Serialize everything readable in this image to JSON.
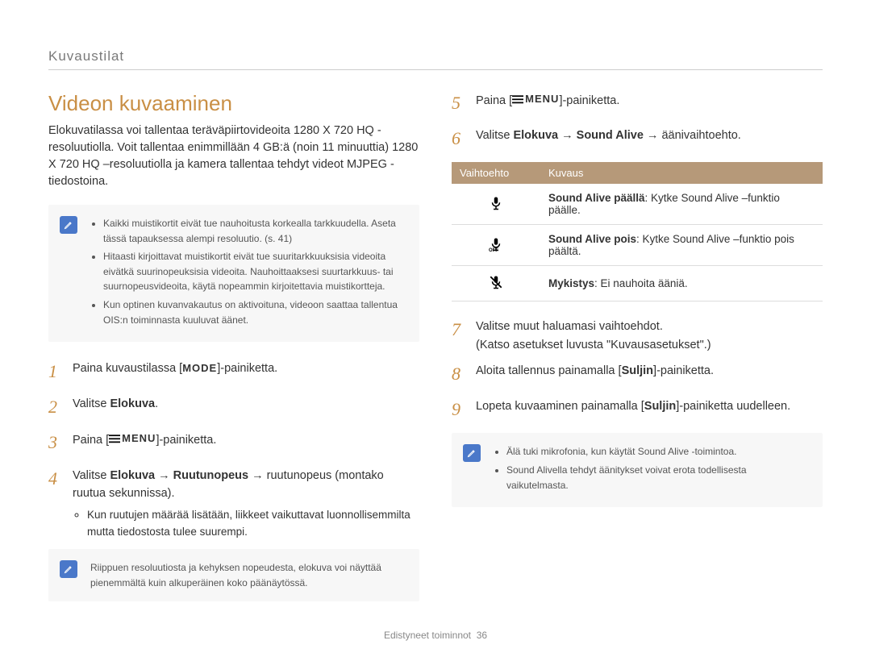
{
  "header": {
    "section_label": "Kuvaustilat"
  },
  "title": "Videon kuvaaminen",
  "intro": "Elokuvatilassa voi tallentaa teräväpiirtovideoita 1280 X 720 HQ -resoluutiolla. Voit tallentaa enimmillään 4 GB:ä (noin 11 minuuttia) 1280 X 720 HQ –resoluutiolla ja kamera tallentaa tehdyt videot MJPEG -tiedostoina.",
  "note_left_1": {
    "items": [
      "Kaikki muistikortit eivät tue nauhoitusta korkealla tarkkuudella. Aseta tässä tapauksessa alempi resoluutio. (s. 41)",
      "Hitaasti kirjoittavat muistikortit eivät tue suuritarkkuuksisia videoita eivätkä suurinopeuksisia videoita. Nauhoittaaksesi suurtarkkuus- tai suurnopeusvideoita, käytä nopeammin kirjoitettavia muistikortteja.",
      "Kun optinen kuvanvakautus on aktivoituna, videoon saattaa tallentua OIS:n toiminnasta kuuluvat äänet."
    ]
  },
  "steps_left": [
    {
      "n": "1",
      "pre": "Paina kuvaustilassa [",
      "mid_label": "MODE",
      "post": "]-painiketta."
    },
    {
      "n": "2",
      "pre": "Valitse ",
      "bold": "Elokuva",
      "post": "."
    },
    {
      "n": "3",
      "pre": "Paina [",
      "icon": "menu",
      "post": "]-painiketta."
    },
    {
      "n": "4",
      "parts": [
        "Valitse ",
        "Elokuva",
        " → ",
        "Ruutunopeus",
        " → ruutunopeus (montako ruutua sekunnissa)."
      ],
      "bullet": "Kun ruutujen määrää lisätään, liikkeet vaikuttavat luonnollisemmilta mutta tiedostosta tulee suurempi."
    }
  ],
  "note_left_2": "Riippuen resoluutiosta ja kehyksen nopeudesta, elokuva voi näyttää pienemmältä kuin alkuperäinen koko päänäytössä.",
  "steps_right_top": [
    {
      "n": "5",
      "pre": "Paina [",
      "icon": "menu",
      "post": "]-painiketta."
    },
    {
      "n": "6",
      "parts": [
        "Valitse ",
        "Elokuva",
        " → ",
        "Sound Alive",
        " → äänivaihtoehto."
      ]
    }
  ],
  "table": {
    "headers": [
      "Vaihtoehto",
      "Kuvaus"
    ],
    "rows": [
      {
        "icon": "mic-on",
        "bold": "Sound Alive päällä",
        "text": ": Kytke Sound Alive –funktio päälle."
      },
      {
        "icon": "mic-off",
        "bold": "Sound Alive pois",
        "text": ": Kytke Sound Alive –funktio pois päältä."
      },
      {
        "icon": "mic-mute",
        "bold": "Mykistys",
        "text": ": Ei nauhoita ääniä."
      }
    ]
  },
  "steps_right_bottom": [
    {
      "n": "7",
      "text_a": "Valitse muut haluamasi vaihtoehdot.",
      "text_b": "(Katso asetukset luvusta \"Kuvausasetukset\".)"
    },
    {
      "n": "8",
      "parts": [
        "Aloita tallennus painamalla [",
        "Suljin",
        "]-painiketta."
      ]
    },
    {
      "n": "9",
      "parts": [
        "Lopeta kuvaaminen painamalla [",
        "Suljin",
        "]-painiketta uudelleen."
      ]
    }
  ],
  "note_right": {
    "items": [
      "Älä tuki mikrofonia, kun käytät Sound Alive -toimintoa.",
      "Sound Alivella tehdyt äänitykset voivat erota todellisesta vaikutelmasta."
    ]
  },
  "footer": {
    "label": "Edistyneet toiminnot",
    "page": "36"
  }
}
